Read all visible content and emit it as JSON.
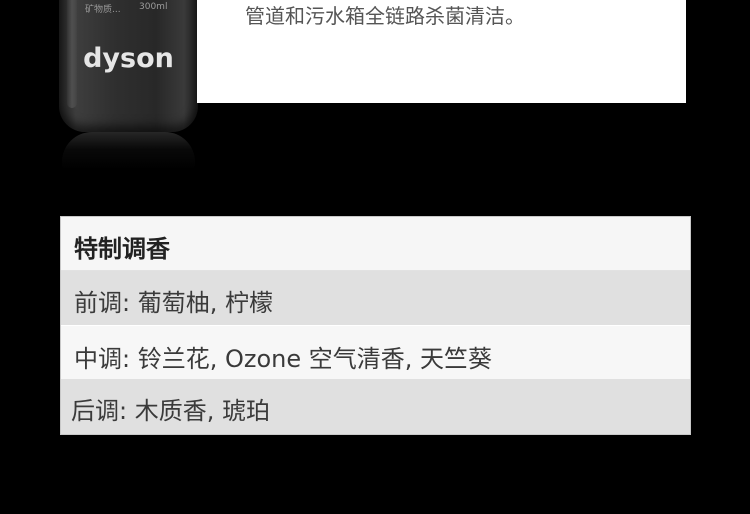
{
  "bottle": {
    "top_left_label": "矿物质...",
    "top_right_label": "300ml",
    "brand_logo": "dyson"
  },
  "top_panel": {
    "text": "管道和污水箱全链路杀菌清洁。"
  },
  "fragrance": {
    "title": "特制调香",
    "top_notes": "前调: 葡萄柚, 柠檬",
    "middle_notes": "中调: 铃兰花, Ozone 空气清香, 天竺葵",
    "base_notes": "后调: 木质香, 琥珀"
  }
}
